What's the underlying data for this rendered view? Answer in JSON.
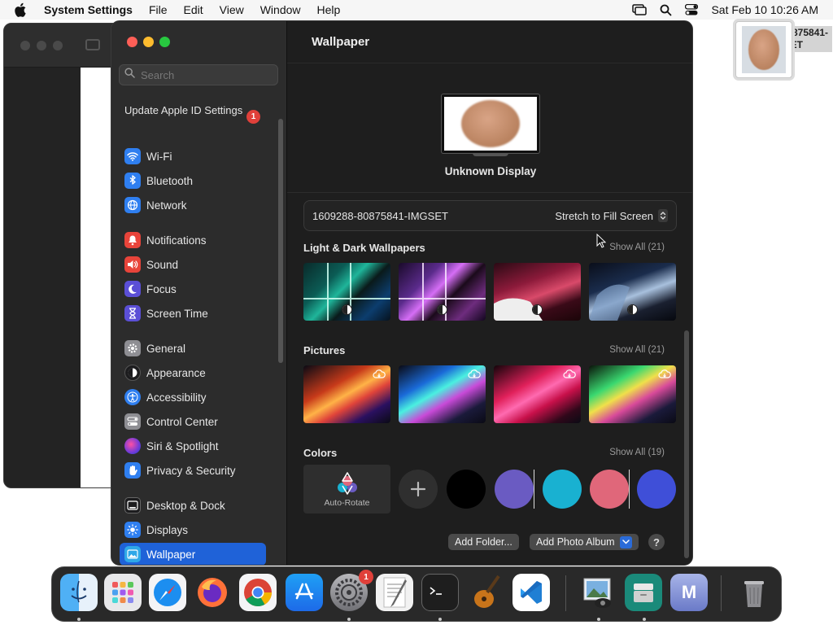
{
  "menubar": {
    "app_name": "System Settings",
    "menus": [
      "File",
      "Edit",
      "View",
      "Window",
      "Help"
    ],
    "datetime": "Sat Feb 10  10:26 AM"
  },
  "desktop_file": {
    "name": "1609288-80875841-IMGSET"
  },
  "sidebar": {
    "search_placeholder": "Search",
    "apple_id": {
      "label": "Update Apple ID Settings",
      "badge": "1"
    },
    "items": [
      {
        "label": "Wi-Fi",
        "icon": "wifi-icon",
        "color": "#2f7ff0"
      },
      {
        "label": "Bluetooth",
        "icon": "bluetooth-icon",
        "color": "#2f7ff0"
      },
      {
        "label": "Network",
        "icon": "globe-icon",
        "color": "#2f7ff0"
      },
      {
        "label": "Notifications",
        "icon": "bell-icon",
        "color": "#e8443a"
      },
      {
        "label": "Sound",
        "icon": "speaker-icon",
        "color": "#e8443a"
      },
      {
        "label": "Focus",
        "icon": "moon-icon",
        "color": "#5b4fd6"
      },
      {
        "label": "Screen Time",
        "icon": "hourglass-icon",
        "color": "#5b4fd6"
      },
      {
        "label": "General",
        "icon": "gear-icon",
        "color": "#8e8e93"
      },
      {
        "label": "Appearance",
        "icon": "appearance-icon",
        "color": "#1c1c1e"
      },
      {
        "label": "Accessibility",
        "icon": "accessibility-icon",
        "color": "#2f7ff0"
      },
      {
        "label": "Control Center",
        "icon": "control-center-icon",
        "color": "#8e8e93"
      },
      {
        "label": "Siri & Spotlight",
        "icon": "siri-icon",
        "color": "#7a3cd6"
      },
      {
        "label": "Privacy & Security",
        "icon": "hand-icon",
        "color": "#2f7ff0"
      },
      {
        "label": "Desktop & Dock",
        "icon": "dock-icon",
        "color": "#1c1c1e"
      },
      {
        "label": "Displays",
        "icon": "sun-icon",
        "color": "#2f7ff0"
      },
      {
        "label": "Wallpaper",
        "icon": "wallpaper-icon",
        "color": "#2fa8e8"
      }
    ]
  },
  "content": {
    "title": "Wallpaper",
    "display_label": "Unknown Display",
    "current_file": "1609288-80875841-IMGSET",
    "fill_mode": "Stretch to Fill Screen",
    "sections": {
      "light_dark": {
        "label": "Light & Dark Wallpapers",
        "show_all": "Show All (21)"
      },
      "pictures": {
        "label": "Pictures",
        "show_all": "Show All (21)"
      },
      "colors": {
        "label": "Colors",
        "show_all": "Show All (19)"
      }
    },
    "auto_rotate_label": "Auto-Rotate",
    "color_swatches": [
      "#000000",
      "#6a5bc2",
      "#19b1d1",
      "#e0677a",
      "#3f4fd8"
    ],
    "buttons": {
      "add_folder": "Add Folder...",
      "add_photo_album": "Add Photo Album",
      "help": "?"
    }
  },
  "dock": {
    "apps": [
      {
        "name": "Finder",
        "icon": "finder-icon"
      },
      {
        "name": "Launchpad",
        "icon": "launchpad-icon"
      },
      {
        "name": "Safari",
        "icon": "safari-icon"
      },
      {
        "name": "Firefox",
        "icon": "firefox-icon"
      },
      {
        "name": "Chrome",
        "icon": "chrome-icon"
      },
      {
        "name": "App Store",
        "icon": "app-store-icon"
      },
      {
        "name": "System Settings",
        "icon": "system-settings-icon",
        "badge": "1"
      },
      {
        "name": "TextEdit",
        "icon": "textedit-icon"
      },
      {
        "name": "Terminal",
        "icon": "terminal-icon"
      },
      {
        "name": "Instruments",
        "icon": "instruments-icon"
      },
      {
        "name": "VS Code",
        "icon": "vscode-icon"
      },
      {
        "name": "Preview",
        "icon": "preview-icon"
      },
      {
        "name": "Archive",
        "icon": "archive-icon"
      },
      {
        "name": "M",
        "icon": "m-app-icon",
        "letter": "M"
      },
      {
        "name": "Trash",
        "icon": "trash-icon"
      }
    ]
  }
}
